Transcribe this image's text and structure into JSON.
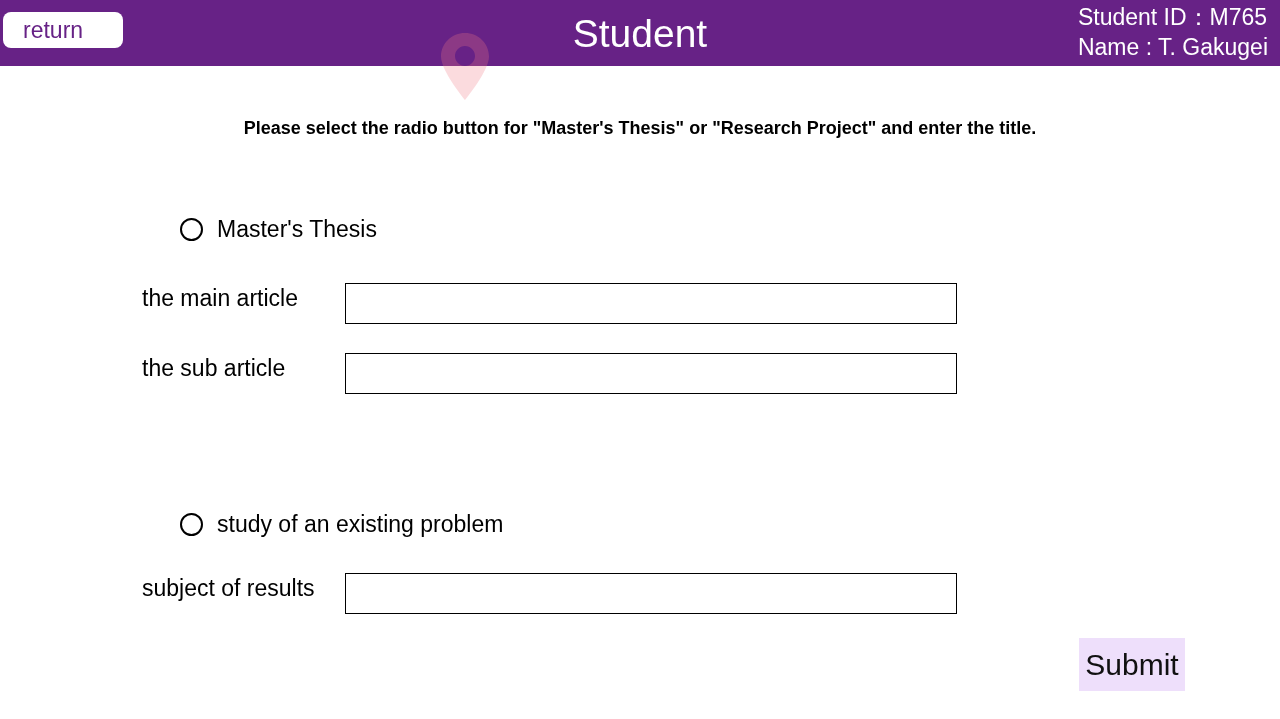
{
  "header": {
    "back_button": "return",
    "title": "Student",
    "student_id": "Student ID：M765",
    "name": "Name : T. Gakugei"
  },
  "instruction": "Please select the radio button for \"Master's Thesis\" or \"Research Project\" and enter the title.",
  "options": [
    {
      "label": "Master's Thesis",
      "selected": false,
      "fields": [
        {
          "label": "the main article"
        },
        {
          "label": "the sub article"
        }
      ]
    },
    {
      "label": "study of an existing problem",
      "selected": false,
      "fields": [
        {
          "label": "subject of results"
        }
      ]
    }
  ],
  "submit_button": "Submit"
}
